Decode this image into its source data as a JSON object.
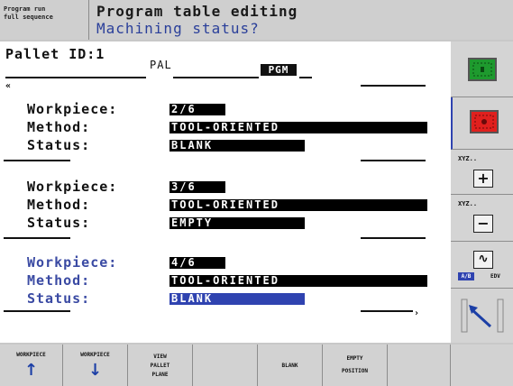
{
  "header": {
    "mode_line1": "Program run",
    "mode_line2": "full sequence",
    "title": "Program table editing",
    "subtitle": "Machining status?"
  },
  "main": {
    "pallet_label": "Pallet ID:1",
    "pal_label": "PAL",
    "pgm_label": "PGM",
    "scroll_left": "«",
    "scroll_right": "›",
    "blocks": [
      {
        "workpiece_label": "Workpiece:",
        "workpiece": "2/6",
        "method_label": "Method:",
        "method": "TOOL-ORIENTED",
        "status_label": "Status:",
        "status": "BLANK"
      },
      {
        "workpiece_label": "Workpiece:",
        "workpiece": "3/6",
        "method_label": "Method:",
        "method": "TOOL-ORIENTED",
        "status_label": "Status:",
        "status": "EMPTY"
      },
      {
        "workpiece_label": "Workpiece:",
        "workpiece": "4/6",
        "method_label": "Method:",
        "method": "TOOL-ORIENTED",
        "status_label": "Status:",
        "status": "BLANK"
      }
    ]
  },
  "right_softkeys": {
    "xyz_plus_label": "XYZ..",
    "xyz_minus_label": "XYZ..",
    "plus": "+",
    "minus": "−",
    "wave": "∿",
    "ab_label": "A/B",
    "edv_label": "EDV"
  },
  "softkeys": [
    {
      "line1": "WORKPIECE",
      "line2": "",
      "line3": "",
      "icon": "arrow-up-icon",
      "glyph": "↑"
    },
    {
      "line1": "WORKPIECE",
      "line2": "",
      "line3": "",
      "icon": "arrow-down-icon",
      "glyph": "↓"
    },
    {
      "line1": "VIEW",
      "line2": "PALLET",
      "line3": "PLANE",
      "icon": "",
      "glyph": ""
    },
    {
      "line1": "",
      "line2": "",
      "line3": "",
      "icon": "",
      "glyph": ""
    },
    {
      "line1": "BLANK",
      "line2": "",
      "line3": "",
      "icon": "",
      "glyph": ""
    },
    {
      "line1": "EMPTY",
      "line2": "POSITION",
      "line3": "",
      "icon": "",
      "glyph": ""
    },
    {
      "line1": "",
      "line2": "",
      "line3": "",
      "icon": "",
      "glyph": ""
    },
    {
      "line1": "",
      "line2": "",
      "line3": "",
      "icon": "",
      "glyph": ""
    }
  ],
  "colors": {
    "accent_blue": "#2f43b0",
    "field_blue": "#3a4aa3",
    "green_key": "#1e9a2e",
    "red_key": "#e0201e"
  }
}
